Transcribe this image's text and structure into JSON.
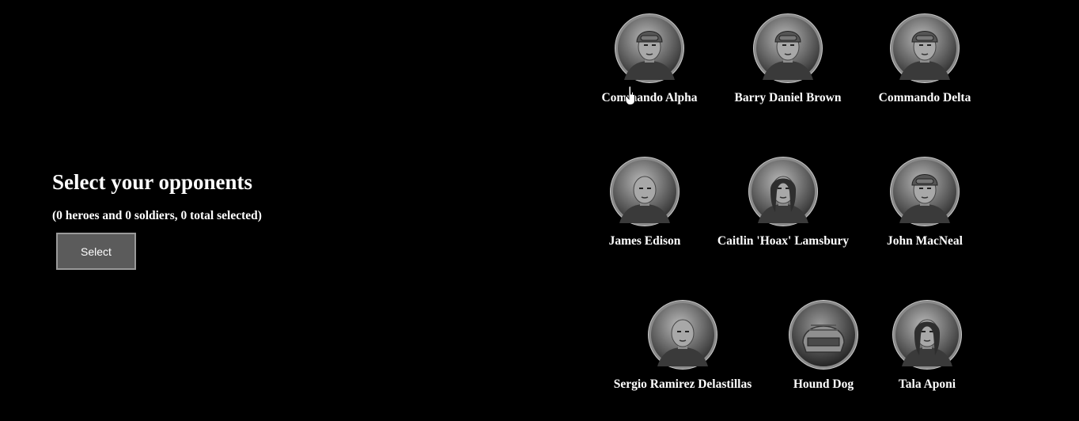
{
  "page": {
    "title": "Select your opponents",
    "selection_summary": "(0 heroes and 0 soldiers, 0 total selected)",
    "select_button_label": "Select"
  },
  "selection": {
    "heroes": 0,
    "soldiers": 0,
    "total": 0
  },
  "characters": [
    {
      "name": "Commando Alpha",
      "portrait": "helmeted-soldier-portrait"
    },
    {
      "name": "Barry Daniel Brown",
      "portrait": "helmeted-soldier-portrait"
    },
    {
      "name": "Commando Delta",
      "portrait": "helmeted-soldier-portrait"
    },
    {
      "name": "James Edison",
      "portrait": "soldier-portrait"
    },
    {
      "name": "Caitlin 'Hoax' Lamsbury",
      "portrait": "female-soldier-portrait"
    },
    {
      "name": "John MacNeal",
      "portrait": "helmeted-soldier-portrait"
    },
    {
      "name": "Sergio Ramirez Delastillas",
      "portrait": "soldier-portrait"
    },
    {
      "name": "Hound Dog",
      "portrait": "armored-helmet-portrait"
    },
    {
      "name": "Tala Aponi",
      "portrait": "female-hero-portrait"
    }
  ],
  "colors": {
    "background": "#000000",
    "text": "#ffffff",
    "button_fill": "#5b5b5b",
    "button_border": "#9a9a9a",
    "portrait_ring": "#c8c8c8"
  }
}
